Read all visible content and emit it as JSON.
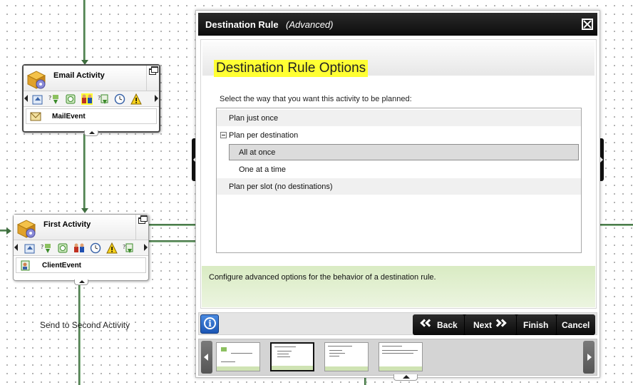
{
  "canvas": {
    "connector_label": "Send to Second Activity"
  },
  "activities": [
    {
      "title": "Email Activity",
      "event_label": "MailEvent",
      "highlighted_tool": "destination-rule-icon"
    },
    {
      "title": "First Activity",
      "event_label": "ClientEvent"
    }
  ],
  "wizard": {
    "title": "Destination Rule",
    "subtitle": "(Advanced)",
    "section_title": "Destination Rule Options",
    "prompt": "Select the way that you want this activity to be planned:",
    "options": [
      {
        "label": "Plan just once"
      },
      {
        "label": "Plan per destination",
        "expanded": true
      },
      {
        "label": "All at once",
        "selected": true
      },
      {
        "label": "One at a time"
      },
      {
        "label": "Plan per slot (no destinations)"
      }
    ],
    "description": "Configure advanced options for the behavior of a destination rule.",
    "buttons": {
      "back": "Back",
      "next": "Next",
      "finish": "Finish",
      "cancel": "Cancel"
    },
    "thumbnail_count": 4,
    "active_thumbnail": 2
  },
  "colors": {
    "highlight": "#ffff33",
    "description_bg": "#d9ebc3",
    "title_bar": "#111111",
    "connector": "#5a8a5a"
  }
}
